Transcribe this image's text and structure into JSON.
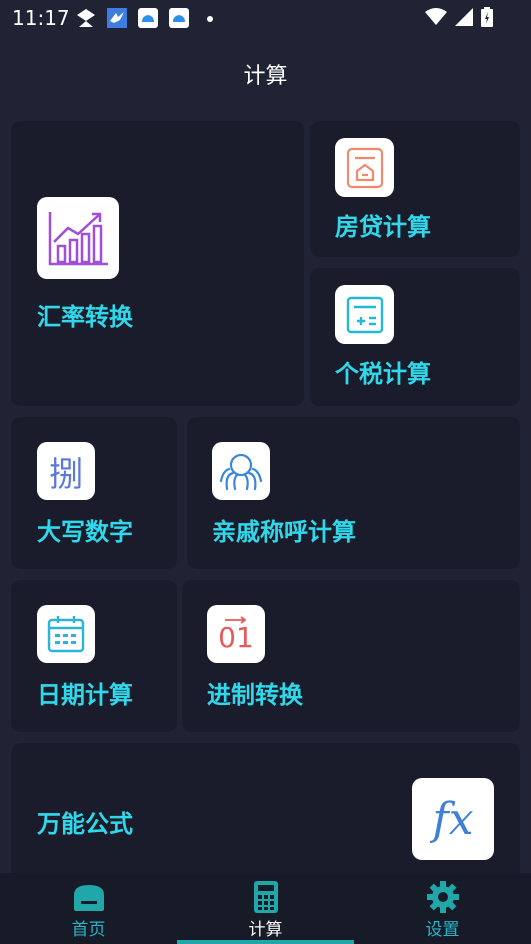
{
  "status_bar": {
    "time": "11:17"
  },
  "header": {
    "title": "计算"
  },
  "cards": {
    "exchange": {
      "label": "汇率转换"
    },
    "mortgage": {
      "label": "房贷计算"
    },
    "tax": {
      "label": "个税计算"
    },
    "uppercase": {
      "label": "大写数字",
      "icon_text": "捌"
    },
    "relatives": {
      "label": "亲戚称呼计算"
    },
    "date": {
      "label": "日期计算"
    },
    "base": {
      "label": "进制转换",
      "icon_text": "01"
    },
    "formula": {
      "label": "万能公式",
      "icon_text": "fx"
    }
  },
  "bottom_nav": {
    "items": [
      {
        "label": "首页",
        "icon": "home-icon"
      },
      {
        "label": "计算",
        "icon": "calculator-icon"
      },
      {
        "label": "设置",
        "icon": "gear-icon"
      }
    ],
    "active": "计算"
  },
  "colors": {
    "accent": "#2fd8ea",
    "background": "#1f2334",
    "card": "#1a1c2b",
    "nav_accent": "#26b6c6"
  }
}
